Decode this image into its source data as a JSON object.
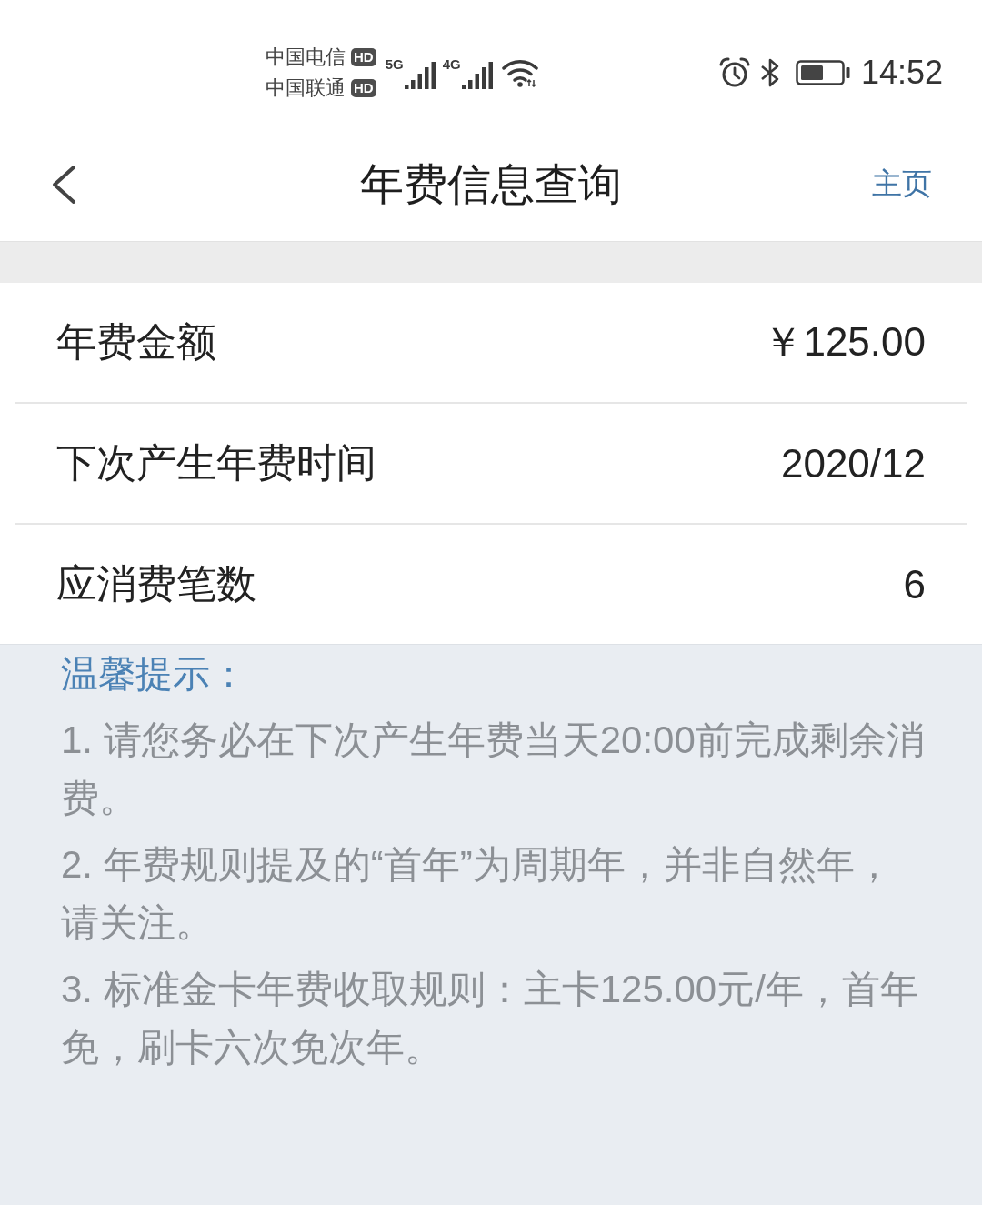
{
  "status_bar": {
    "carriers": [
      {
        "name": "中国电信",
        "badge": "HD"
      },
      {
        "name": "中国联通",
        "badge": "HD"
      }
    ],
    "signals": [
      {
        "network": "5G"
      },
      {
        "network": "4G"
      }
    ],
    "time": "14:52"
  },
  "nav": {
    "title": "年费信息查询",
    "home_link": "主页"
  },
  "rows": [
    {
      "label": "年费金额",
      "value": "￥125.00"
    },
    {
      "label": "下次产生年费时间",
      "value": "2020/12"
    },
    {
      "label": "应消费笔数",
      "value": "6"
    }
  ],
  "tips": {
    "title": "温馨提示：",
    "items": [
      "1. 请您务必在下次产生年费当天20:00前完成剩余消费。",
      "2. 年费规则提及的“首年”为周期年，并非自然年，请关注。",
      "3. 标准金卡年费收取规则：主卡125.00元/年，首年免，刷卡六次免次年。"
    ]
  }
}
